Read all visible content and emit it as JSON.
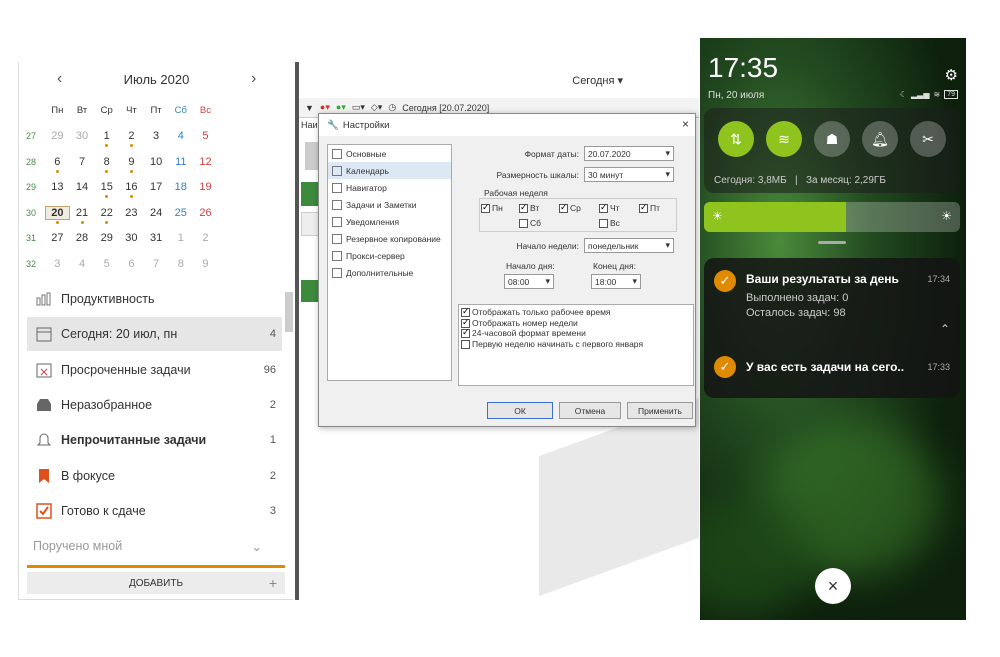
{
  "calendar": {
    "month": "Июль 2020",
    "weekdays": [
      "Пн",
      "Вт",
      "Ср",
      "Чт",
      "Пт",
      "Сб",
      "Вс"
    ],
    "weeks": [
      {
        "num": "27",
        "days": [
          "29",
          "30",
          "1",
          "2",
          "3",
          "4",
          "5"
        ]
      },
      {
        "num": "28",
        "days": [
          "6",
          "7",
          "8",
          "9",
          "10",
          "11",
          "12"
        ]
      },
      {
        "num": "29",
        "days": [
          "13",
          "14",
          "15",
          "16",
          "17",
          "18",
          "19"
        ]
      },
      {
        "num": "30",
        "days": [
          "20",
          "21",
          "22",
          "23",
          "24",
          "25",
          "26"
        ]
      },
      {
        "num": "31",
        "days": [
          "27",
          "28",
          "29",
          "30",
          "31",
          "1",
          "2"
        ]
      },
      {
        "num": "32",
        "days": [
          "3",
          "4",
          "5",
          "6",
          "7",
          "8",
          "9"
        ]
      }
    ]
  },
  "sidebar": {
    "productivity": "Продуктивность",
    "items": [
      {
        "label": "Сегодня: 20 июл, пн",
        "count": "4"
      },
      {
        "label": "Просроченные задачи",
        "count": "96"
      },
      {
        "label": "Неразобранное",
        "count": "2"
      },
      {
        "label": "Непрочитанные задачи",
        "count": "1"
      },
      {
        "label": "В фокусе",
        "count": "2"
      },
      {
        "label": "Готово к сдаче",
        "count": "3"
      }
    ],
    "assigned": "Поручено мной",
    "add": "ДОБАВИТЬ"
  },
  "main": {
    "today": "Сегодня",
    "toolbar_date": "Сегодня [20.07.2020]",
    "col": "Наи"
  },
  "dialog": {
    "title": "Настройки",
    "nav": [
      "Основные",
      "Календарь",
      "Навигатор",
      "Задачи и Заметки",
      "Уведомления",
      "Резервное копирование",
      "Прокси-сервер",
      "Дополнительные"
    ],
    "date_format_label": "Формат даты:",
    "date_format": "20.07.2020",
    "scale_label": "Размерность шкалы:",
    "scale": "30 минут",
    "workweek_label": "Рабочая неделя",
    "days": [
      "Пн",
      "Вт",
      "Ср",
      "Чт",
      "Пт",
      "Сб",
      "Вс"
    ],
    "week_start_label": "Начало недели:",
    "week_start": "понедельник",
    "day_start_label": "Начало дня:",
    "day_start": "08:00",
    "day_end_label": "Конец дня:",
    "day_end": "18:00",
    "options": [
      "Отображать только рабочее время",
      "Отображать номер недели",
      "24-часовой формат времени",
      "Первую неделю начинать с первого января"
    ],
    "ok": "ОК",
    "cancel": "Отмена",
    "apply": "Применить"
  },
  "phone": {
    "time": "17:35",
    "date": "Пн, 20 июля",
    "battery": "79",
    "usage": "Сегодня: 3,8МБ   |   За месяц: 2,29ГБ",
    "n1": {
      "title": "Ваши результаты за день",
      "time": "17:34",
      "line1": "Выполнено задач: 0",
      "line2": "Осталось задач: 98"
    },
    "n2": {
      "title": "У вас есть задачи на сего..",
      "time": "17:33"
    }
  },
  "colors": {
    "accent": "#e08a00",
    "green": "#8fc41e"
  }
}
